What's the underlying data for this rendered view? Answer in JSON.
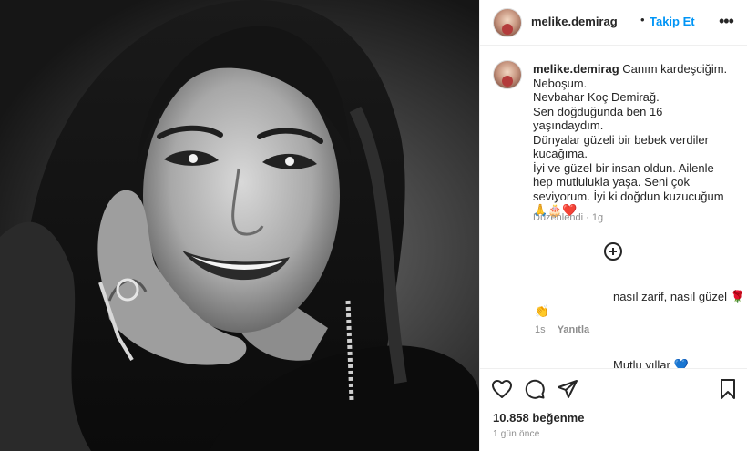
{
  "post": {
    "username": "melike.demirag",
    "follow_separator": "•",
    "follow_label": "Takip Et",
    "more_label": "•••"
  },
  "caption": {
    "username": "melike.demirag",
    "lines": [
      "Canım kardeşciğim.",
      "Neboşum.",
      "Nevbahar Koç Demirağ.",
      "Sen doğduğunda ben 16 yaşındaydım.",
      "Dünyalar güzeli bir bebek verdiler",
      "kucağıma.",
      "İyi ve güzel bir insan oldun. Ailenle",
      "hep mutlulukla yaşa. Seni çok",
      "seviyorum. İyi ki doğdun kuzucuğum",
      "🙏🎂❤️"
    ],
    "edited_label": "Düzenlendi",
    "edited_sep": "·",
    "edited_time": "1g"
  },
  "comments": [
    {
      "text": "nasıl zarif, nasıl güzel 🌹",
      "emoji": "👏",
      "time": "1s",
      "reply_label": "Yanıtla"
    },
    {
      "text": "Mutlu yıllar 💙"
    }
  ],
  "actions": {
    "likes": "10.858 beğenme",
    "ago": "1 gün önce"
  },
  "icons": {
    "like": "heart-icon",
    "comment": "comment-icon",
    "share": "share-icon",
    "save": "bookmark-icon",
    "more": "more-icon",
    "load_more": "plus-circle-icon"
  }
}
